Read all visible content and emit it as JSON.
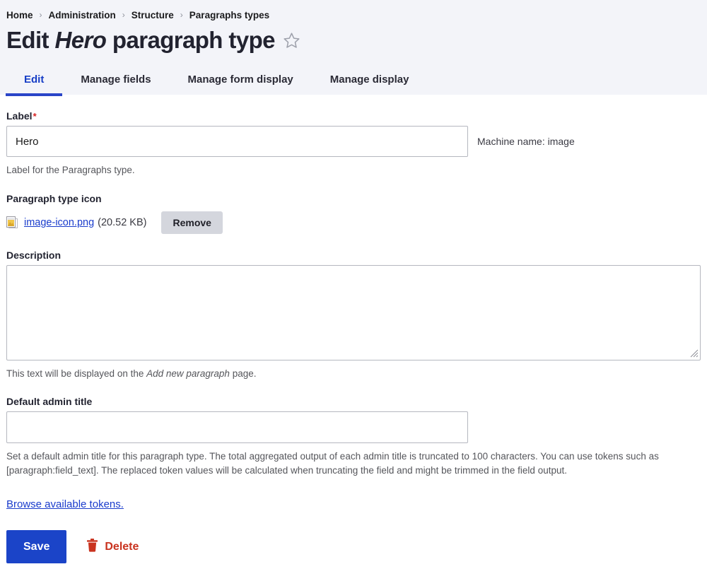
{
  "breadcrumb": {
    "items": [
      "Home",
      "Administration",
      "Structure",
      "Paragraphs types"
    ],
    "separator": "›"
  },
  "header": {
    "title_prefix": "Edit",
    "title_emphasis": "Hero",
    "title_suffix": "paragraph type",
    "star_icon": "star-outline-icon"
  },
  "tabs": [
    {
      "label": "Edit",
      "active": true
    },
    {
      "label": "Manage fields",
      "active": false
    },
    {
      "label": "Manage form display",
      "active": false
    },
    {
      "label": "Manage display",
      "active": false
    }
  ],
  "form": {
    "label_field": {
      "label": "Label",
      "required_marker": "*",
      "value": "Hero",
      "machine_name": "Machine name: image",
      "description": "Label for the Paragraphs type."
    },
    "icon_field": {
      "label": "Paragraph type icon",
      "file_icon": "file-image-icon",
      "file_name": "image-icon.png",
      "file_size": "(20.52 KB)",
      "remove_label": "Remove"
    },
    "description_field": {
      "label": "Description",
      "value": "",
      "help_prefix": "This text will be displayed on the ",
      "help_emphasis": "Add new paragraph",
      "help_suffix": " page."
    },
    "admin_title_field": {
      "label": "Default admin title",
      "value": "",
      "help": "Set a default admin title for this paragraph type. The total aggregated output of each admin title is truncated to 100 characters. You can use tokens such as [paragraph:field_text]. The replaced token values will be calculated when truncating the field and might be trimmed in the field output."
    },
    "tokens_link": "Browse available tokens."
  },
  "actions": {
    "save_label": "Save",
    "delete_label": "Delete",
    "delete_icon": "trash-icon"
  },
  "colors": {
    "accent_blue": "#1b44c8",
    "link_blue": "#1a3ccc",
    "delete_red": "#c9331f",
    "required_red": "#d72222",
    "header_bg": "#f3f4f9"
  }
}
